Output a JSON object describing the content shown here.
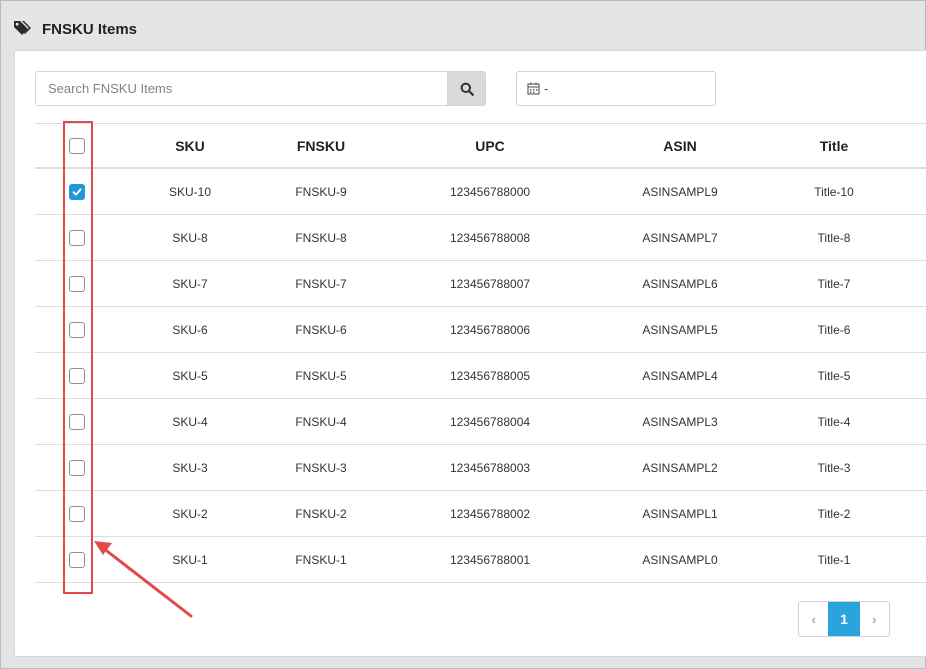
{
  "header": {
    "title": "FNSKU Items",
    "icon": "tag-icon"
  },
  "search": {
    "placeholder": "Search FNSKU Items",
    "value": "",
    "button_icon": "search-icon"
  },
  "date_filter": {
    "icon": "calendar-icon",
    "value": "-"
  },
  "table": {
    "columns": [
      "SKU",
      "FNSKU",
      "UPC",
      "ASIN",
      "Title"
    ],
    "rows": [
      {
        "checked": true,
        "sku": "SKU-10",
        "fnsku": "FNSKU-9",
        "upc": "123456788000",
        "asin": "ASINSAMPL9",
        "title": "Title-10"
      },
      {
        "checked": false,
        "sku": "SKU-8",
        "fnsku": "FNSKU-8",
        "upc": "123456788008",
        "asin": "ASINSAMPL7",
        "title": "Title-8"
      },
      {
        "checked": false,
        "sku": "SKU-7",
        "fnsku": "FNSKU-7",
        "upc": "123456788007",
        "asin": "ASINSAMPL6",
        "title": "Title-7"
      },
      {
        "checked": false,
        "sku": "SKU-6",
        "fnsku": "FNSKU-6",
        "upc": "123456788006",
        "asin": "ASINSAMPL5",
        "title": "Title-6"
      },
      {
        "checked": false,
        "sku": "SKU-5",
        "fnsku": "FNSKU-5",
        "upc": "123456788005",
        "asin": "ASINSAMPL4",
        "title": "Title-5"
      },
      {
        "checked": false,
        "sku": "SKU-4",
        "fnsku": "FNSKU-4",
        "upc": "123456788004",
        "asin": "ASINSAMPL3",
        "title": "Title-4"
      },
      {
        "checked": false,
        "sku": "SKU-3",
        "fnsku": "FNSKU-3",
        "upc": "123456788003",
        "asin": "ASINSAMPL2",
        "title": "Title-3"
      },
      {
        "checked": false,
        "sku": "SKU-2",
        "fnsku": "FNSKU-2",
        "upc": "123456788002",
        "asin": "ASINSAMPL1",
        "title": "Title-2"
      },
      {
        "checked": false,
        "sku": "SKU-1",
        "fnsku": "FNSKU-1",
        "upc": "123456788001",
        "asin": "ASINSAMPL0",
        "title": "Title-1"
      }
    ]
  },
  "pagination": {
    "prev": "‹",
    "current": "1",
    "next": "›"
  },
  "colors": {
    "accent": "#2aa4dc",
    "checkbox_checked": "#2199d8",
    "annotation": "#e24a4a"
  }
}
